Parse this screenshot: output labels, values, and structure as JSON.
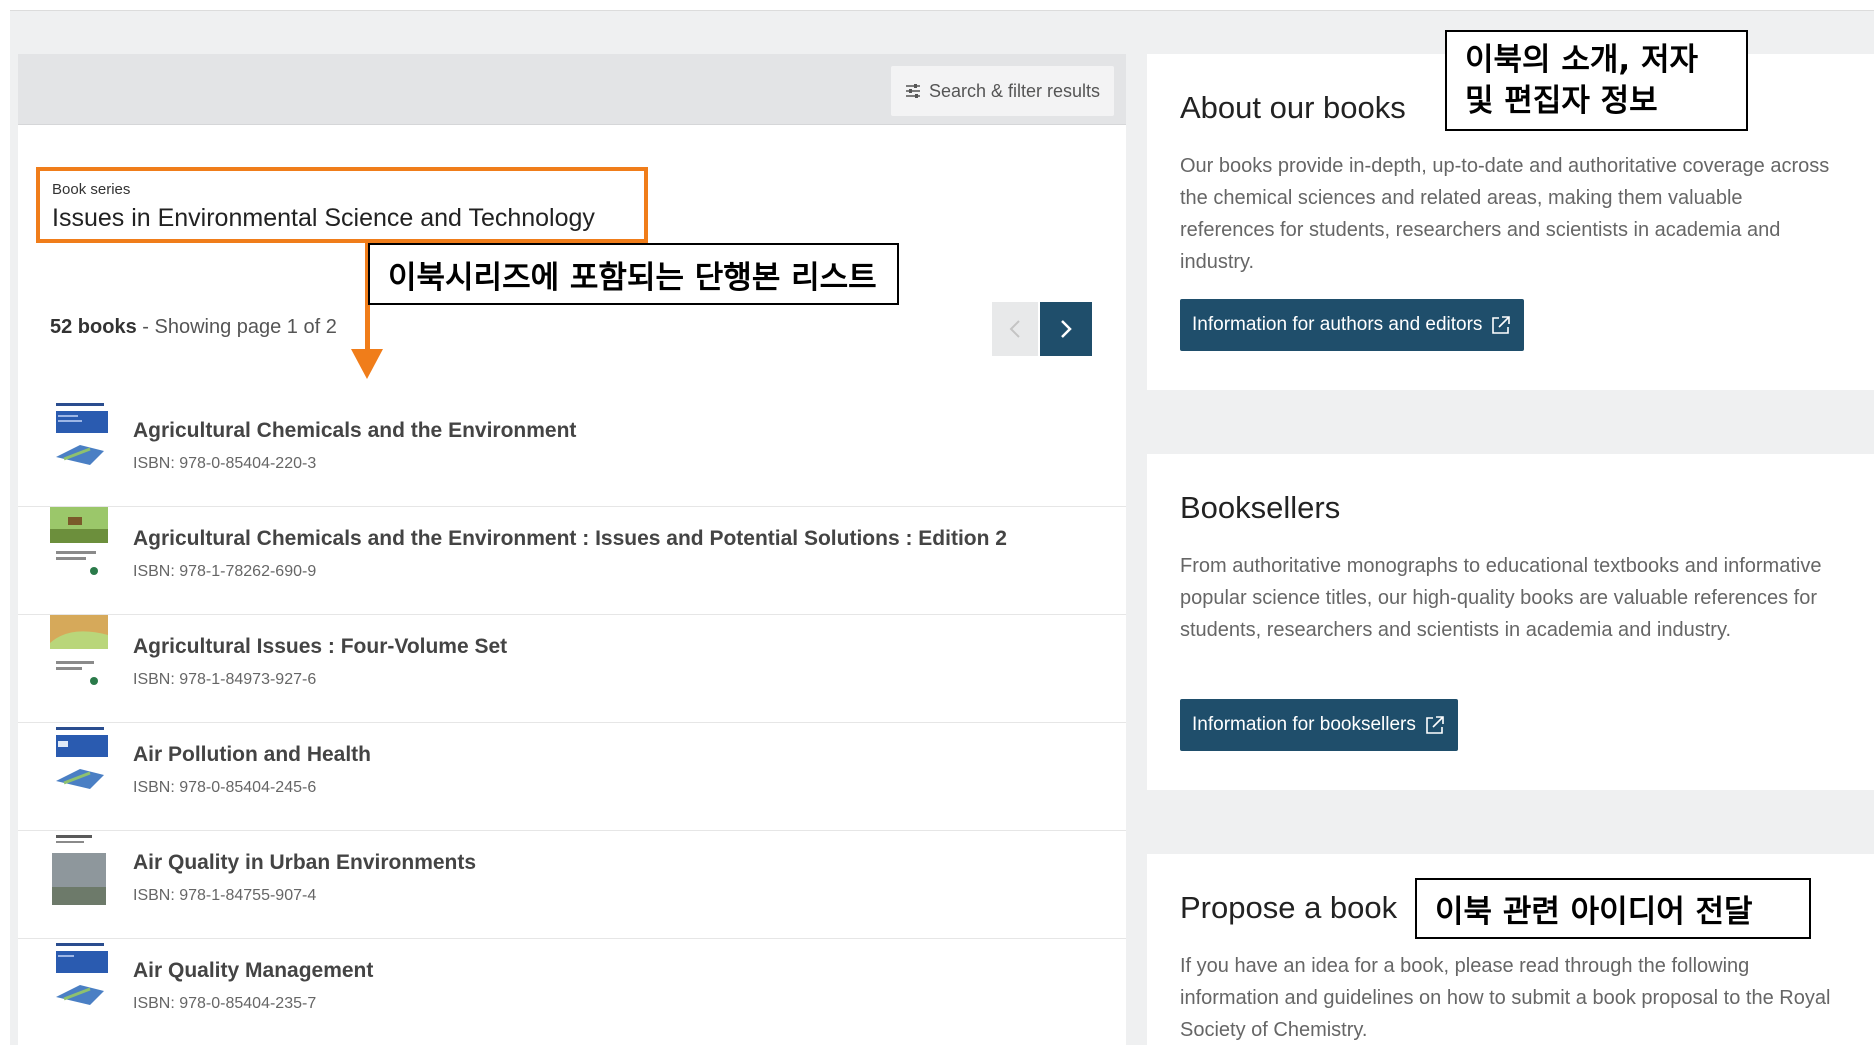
{
  "filter_button": {
    "label": "Search & filter results",
    "icon": "filter-sliders-icon"
  },
  "series": {
    "kicker": "Book series",
    "title": "Issues in Environmental Science and Technology"
  },
  "results": {
    "count": "52 books",
    "showing": " - Showing page 1 of 2"
  },
  "pager": {
    "prev_icon": "chevron-left-icon",
    "next_icon": "chevron-right-icon"
  },
  "annotations": {
    "list": "이북시리즈에 포함되는 단행본 리스트",
    "about_line1": "이북의 소개, 저자",
    "about_line2": "및 편집자 정보",
    "propose": "이북 관련 아이디어 전달"
  },
  "books": [
    {
      "title": "Agricultural Chemicals and the Environment",
      "isbn": "ISBN: 978-0-85404-220-3"
    },
    {
      "title": "Agricultural Chemicals and the Environment : Issues and Potential Solutions : Edition 2",
      "isbn": "ISBN: 978-1-78262-690-9"
    },
    {
      "title": "Agricultural Issues : Four-Volume Set",
      "isbn": "ISBN: 978-1-84973-927-6"
    },
    {
      "title": "Air Pollution and Health",
      "isbn": "ISBN: 978-0-85404-245-6"
    },
    {
      "title": "Air Quality in Urban Environments",
      "isbn": "ISBN: 978-1-84755-907-4"
    },
    {
      "title": "Air Quality Management",
      "isbn": "ISBN: 978-0-85404-235-7"
    }
  ],
  "about": {
    "title": "About our books",
    "text": "Our books provide in-depth, up-to-date and authoritative coverage across the chemical sciences and related areas, making them valuable references for students, researchers and scientists in academia and industry.",
    "button": "Information for authors and editors"
  },
  "booksellers": {
    "title": "Booksellers",
    "text": "From authoritative monographs to educational textbooks and informative popular science titles, our high-quality books are valuable references for students, researchers and scientists in academia and industry.",
    "button": "Information for booksellers"
  },
  "propose": {
    "title": "Propose a book",
    "text": "If you have an idea for a book, please read through the following information and guidelines on how to submit a book proposal to the Royal Society of Chemistry."
  },
  "colors": {
    "accent": "#1f4e6b",
    "highlight": "#f07d1a",
    "background": "#eff0f1"
  }
}
